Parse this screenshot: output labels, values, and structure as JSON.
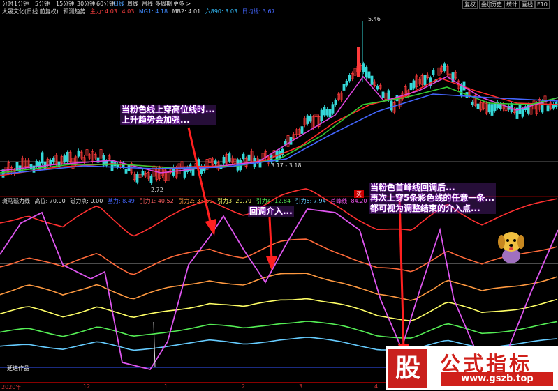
{
  "toolbar": {
    "periods": [
      "分时",
      "1分钟",
      "5分钟",
      "15分钟",
      "30分钟",
      "60分钟",
      "日线",
      "周线",
      "月线",
      "多周期",
      "更多 >"
    ],
    "active_period": "日线",
    "right_buttons": [
      "复权",
      "叠加",
      "历史",
      "统计",
      "画线",
      "F10"
    ]
  },
  "main_legend": {
    "stock": "大晟文化(日线 前复权)",
    "mode": "预测趋势",
    "items": [
      {
        "label": "主力: 4.03",
        "color": "#ff4040"
      },
      {
        "label": "4.03",
        "color": "#ff4040"
      },
      {
        "label": "MG1: 4.18",
        "color": "#3f8bff"
      },
      {
        "label": "MB2: 4.01",
        "color": "#dddddd"
      },
      {
        "label": "六890: 3.03",
        "color": "#35c0ff"
      },
      {
        "label": "日均线: 3.67",
        "color": "#4466ff"
      }
    ]
  },
  "price_labels": {
    "high": "5.46",
    "low": "2.72",
    "range": "3.17 - 3.18"
  },
  "indicator_legend": {
    "name": "斑马磁力线",
    "items": [
      {
        "label": "高位: 70.00",
        "color": "#dddddd"
      },
      {
        "label": "磁力点: 0.00",
        "color": "#dddddd"
      },
      {
        "label": "基力: 8.49",
        "color": "#4466ff"
      },
      {
        "label": "引力1: 40.52",
        "color": "#ff6060"
      },
      {
        "label": "引力2: 33.59",
        "color": "#ff9940"
      },
      {
        "label": "引力3: 20.79",
        "color": "#ffff66"
      },
      {
        "label": "引力4: 12.84",
        "color": "#55ee55"
      },
      {
        "label": "引力5: 7.94",
        "color": "#66ccff"
      },
      {
        "label": "首峰线: 84.20",
        "color": "#ee55ee"
      }
    ]
  },
  "annotations": {
    "a1_line1": "当粉色线上穿高位线时...",
    "a1_line2": "上升趋势会加强...",
    "a2": "回调介入...",
    "a3_line1": "当粉色首峰线回调后...",
    "a3_line2": "再次上穿5条彩色线的任意一条...",
    "a3_line3": "都可视为调整结束的介入点..."
  },
  "signal_marker": "买",
  "footer_left": "延进作品",
  "time_axis": [
    "2020年",
    "12",
    "1",
    "2",
    "3",
    "4"
  ],
  "watermark": {
    "badge": "股",
    "title": "公式指标",
    "url": "www.gszb.top"
  }
}
